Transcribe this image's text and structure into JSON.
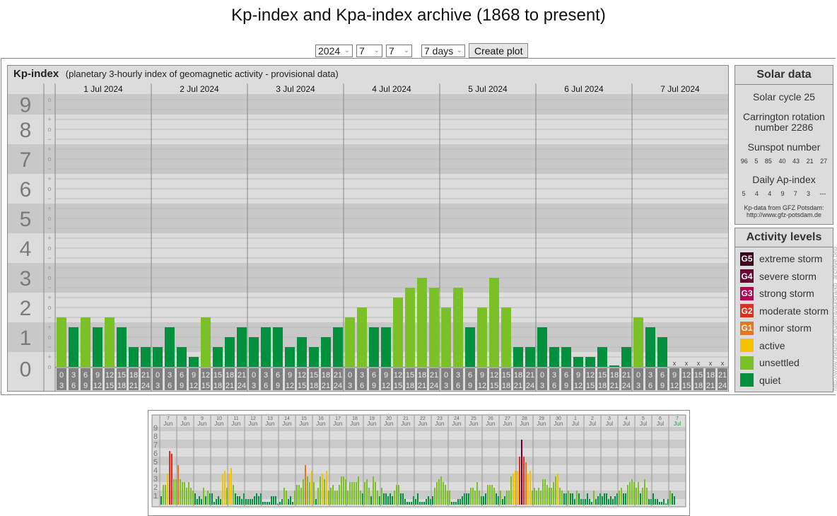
{
  "title": "Kp-index and Kpa-index archive (1868 to present)",
  "controls": {
    "year": "2024",
    "month": "7",
    "day": "7",
    "period": "7 days",
    "button": "Create plot"
  },
  "kp_header": {
    "title": "Kp-index",
    "subtitle": "(planetary 3-hourly index of geomagnetic activity - provisional data)"
  },
  "colors": {
    "quiet": "#00903e",
    "unsettled": "#7bc024",
    "active": "#f6c200",
    "g1": "#e8761c",
    "g2": "#dc2f1e",
    "g3": "#b2004e",
    "g4": "#6c0033",
    "g5": "#3b001c",
    "time_box": "#808080"
  },
  "chart_data": {
    "type": "bar",
    "title": "Kp-index",
    "ylabel": "Kp",
    "ylim": [
      0,
      9
    ],
    "y_ticks": [
      "9",
      "8",
      "7",
      "6",
      "5",
      "4",
      "3",
      "2",
      "1",
      "0"
    ],
    "sub_ticks": [
      "+",
      "o",
      "−"
    ],
    "days": [
      "1 Jul 2024",
      "2 Jul 2024",
      "3 Jul 2024",
      "4 Jul 2024",
      "5 Jul 2024",
      "6 Jul 2024",
      "7 Jul 2024"
    ],
    "time_labels": [
      [
        "0",
        "3"
      ],
      [
        "3",
        "6"
      ],
      [
        "6",
        "9"
      ],
      [
        "9",
        "12"
      ],
      [
        "12",
        "15"
      ],
      [
        "15",
        "18"
      ],
      [
        "18",
        "21"
      ],
      [
        "21",
        "24"
      ]
    ],
    "missing_marker": "x",
    "value_unit": "thirds of Kp (3 = 1o, 4 = 1+, 5 = 2-)",
    "kp_thirds": [
      [
        5,
        4,
        5,
        4,
        5,
        4,
        2,
        2
      ],
      [
        2,
        4,
        2,
        1,
        5,
        2,
        3,
        4
      ],
      [
        3,
        4,
        4,
        2,
        3,
        2,
        3,
        4
      ],
      [
        5,
        6,
        4,
        4,
        7,
        8,
        9,
        8
      ],
      [
        6,
        8,
        4,
        6,
        9,
        6,
        2,
        2
      ],
      [
        4,
        2,
        2,
        1,
        1,
        2,
        0,
        2
      ],
      [
        5,
        4,
        3,
        null,
        null,
        null,
        null,
        null
      ]
    ]
  },
  "solar": {
    "title": "Solar data",
    "cycle": "Solar cycle 25",
    "carrington_1": "Carrington rotation",
    "carrington_2": "number 2286",
    "sunspot_label": "Sunspot number",
    "sunspots": [
      "96",
      "5",
      "85",
      "40",
      "43",
      "21",
      "27"
    ],
    "ap_label": "Daily Ap-index",
    "ap": [
      "5",
      "4",
      "4",
      "9",
      "7",
      "3",
      "---"
    ],
    "source_1": "Kp-data from GFZ Potsdam:",
    "source_2": "http://www.gfz-potsdam.de"
  },
  "activity": {
    "title": "Activity levels",
    "levels": [
      {
        "badge": "G5",
        "label": "extreme storm",
        "color": "#3b001c"
      },
      {
        "badge": "G4",
        "label": "severe storm",
        "color": "#6c0033"
      },
      {
        "badge": "G3",
        "label": "strong storm",
        "color": "#b2004e"
      },
      {
        "badge": "G2",
        "label": "moderate storm",
        "color": "#dc2f1e"
      },
      {
        "badge": "G1",
        "label": "minor storm",
        "color": "#e8761c"
      },
      {
        "badge": "",
        "label": "active",
        "color": "#f6c200"
      },
      {
        "badge": "",
        "label": "unsettled",
        "color": "#7bc024"
      },
      {
        "badge": "",
        "label": "quiet",
        "color": "#00903e"
      }
    ]
  },
  "url": "http://www.theusner.eu/terra/aurora/kp_archive.php",
  "mini_chart": {
    "y_ticks": [
      "9",
      "8",
      "7",
      "6",
      "5",
      "4",
      "3",
      "2",
      "1"
    ],
    "days": [
      [
        "7",
        "Jun"
      ],
      [
        "8",
        "Jun"
      ],
      [
        "9",
        "Jun"
      ],
      [
        "10",
        "Jun"
      ],
      [
        "11",
        "Jun"
      ],
      [
        "12",
        "Jun"
      ],
      [
        "13",
        "Jun"
      ],
      [
        "14",
        "Jun"
      ],
      [
        "15",
        "Jun"
      ],
      [
        "16",
        "Jun"
      ],
      [
        "17",
        "Jun"
      ],
      [
        "18",
        "Jun"
      ],
      [
        "19",
        "Jun"
      ],
      [
        "20",
        "Jun"
      ],
      [
        "21",
        "Jun"
      ],
      [
        "22",
        "Jun"
      ],
      [
        "23",
        "Jun"
      ],
      [
        "24",
        "Jun"
      ],
      [
        "25",
        "Jun"
      ],
      [
        "26",
        "Jun"
      ],
      [
        "27",
        "Jun"
      ],
      [
        "28",
        "Jun"
      ],
      [
        "29",
        "Jun"
      ],
      [
        "30",
        "Jun"
      ],
      [
        "1",
        "Jul"
      ],
      [
        "2",
        "Jul"
      ],
      [
        "3",
        "Jul"
      ],
      [
        "4",
        "Jul"
      ],
      [
        "5",
        "Jul"
      ],
      [
        "6",
        "Jul"
      ],
      [
        "7",
        "Jul"
      ]
    ],
    "kp_thirds": [
      [
        3,
        7,
        7,
        11,
        19,
        18,
        9,
        9
      ],
      [
        14,
        9,
        8,
        8,
        6,
        8,
        6,
        5
      ],
      [
        4,
        2,
        3,
        2,
        6,
        3,
        5,
        4
      ],
      [
        4,
        1,
        2,
        3,
        2,
        11,
        12,
        6
      ],
      [
        11,
        13,
        7,
        4,
        3,
        3,
        2,
        4
      ],
      [
        2,
        2,
        2,
        2,
        3,
        4,
        3,
        4
      ],
      [
        1,
        1,
        1,
        1,
        3,
        3,
        3,
        0
      ],
      [
        1,
        2,
        6,
        5,
        2,
        3,
        1,
        5
      ],
      [
        7,
        7,
        6,
        9,
        14,
        10,
        8,
        12
      ],
      [
        8,
        2,
        6,
        10,
        11,
        9,
        12,
        5
      ],
      [
        6,
        7,
        5,
        5,
        7,
        10,
        10,
        9
      ],
      [
        5,
        8,
        8,
        8,
        8,
        10,
        5,
        4
      ],
      [
        8,
        9,
        6,
        3,
        10,
        8,
        5,
        3
      ],
      [
        6,
        4,
        4,
        3,
        4,
        3,
        5,
        7
      ],
      [
        7,
        4,
        4,
        2,
        1,
        1,
        1,
        3
      ],
      [
        2,
        4,
        1,
        1,
        1,
        2,
        3,
        2
      ],
      [
        3,
        6,
        8,
        9,
        10,
        8,
        7,
        5
      ],
      [
        5,
        1,
        1,
        1,
        2,
        2,
        3,
        4
      ],
      [
        4,
        4,
        6,
        6,
        5,
        8,
        5,
        3
      ],
      [
        3,
        4,
        7,
        7,
        7,
        6,
        4,
        3
      ],
      [
        5,
        2,
        3,
        5,
        5,
        10,
        11,
        12
      ],
      [
        12,
        17,
        23,
        17,
        15,
        11,
        12,
        5
      ],
      [
        6,
        5,
        6,
        5,
        9,
        9,
        7,
        6
      ],
      [
        6,
        8,
        10,
        11,
        6,
        5,
        4,
        4
      ],
      [
        5,
        4,
        4,
        2,
        5,
        4,
        2,
        2
      ],
      [
        2,
        4,
        2,
        1,
        5,
        2,
        3,
        4
      ],
      [
        3,
        4,
        4,
        2,
        3,
        2,
        3,
        4
      ],
      [
        5,
        6,
        4,
        4,
        7,
        8,
        9,
        8
      ],
      [
        6,
        8,
        4,
        6,
        9,
        6,
        2,
        2
      ],
      [
        4,
        2,
        2,
        1,
        1,
        2,
        0,
        2
      ],
      [
        5,
        4,
        3
      ]
    ]
  }
}
